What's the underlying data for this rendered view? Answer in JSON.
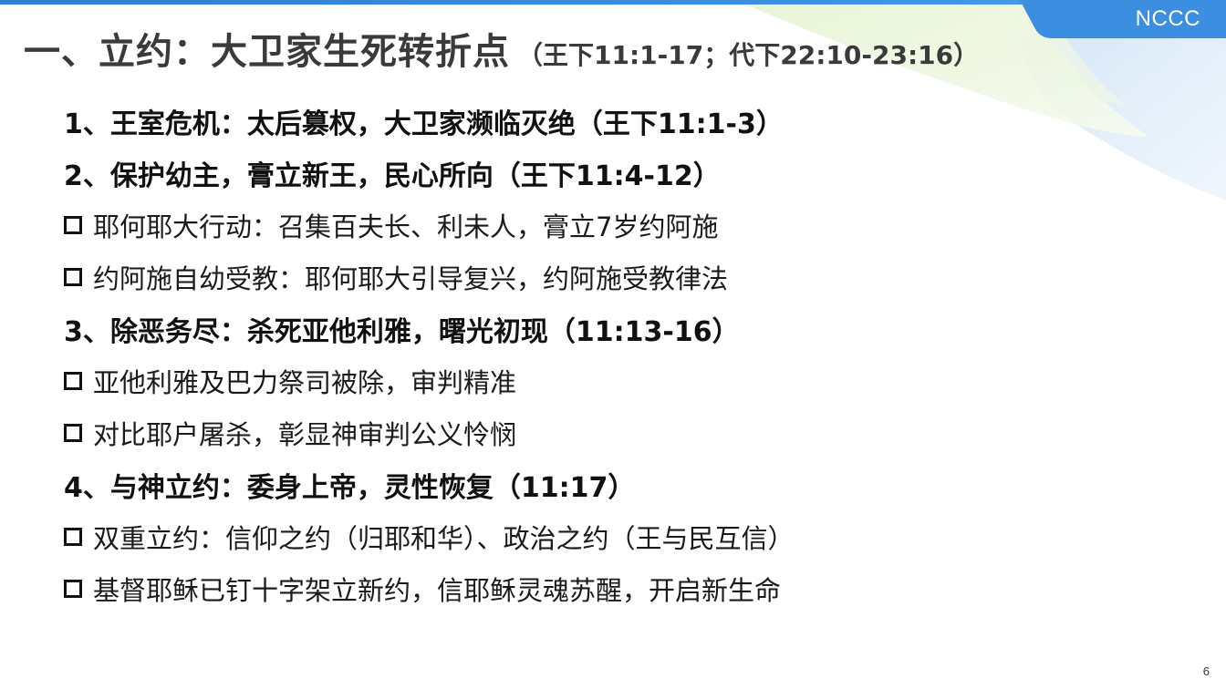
{
  "brand": {
    "label": "NCCC"
  },
  "title": {
    "main": "一、立约：大卫家生死转折点",
    "ref": "（王下11:1-17；代下22:10-23:16）"
  },
  "items": [
    {
      "kind": "heading",
      "text": "1、王室危机：太后篡权，大卫家濒临灭绝（王下11:1-3）"
    },
    {
      "kind": "heading",
      "text": "2、保护幼主，膏立新王，民心所向（王下11:4-12）"
    },
    {
      "kind": "bullet",
      "text": "耶何耶大行动：召集百夫长、利未人，膏立7岁约阿施"
    },
    {
      "kind": "bullet",
      "text": "约阿施自幼受教：耶何耶大引导复兴，约阿施受教律法"
    },
    {
      "kind": "heading",
      "text": "3、除恶务尽：杀死亚他利雅，曙光初现（11:13-16）"
    },
    {
      "kind": "bullet",
      "text": "亚他利雅及巴力祭司被除，审判精准"
    },
    {
      "kind": "bullet",
      "text": "对比耶户屠杀，彰显神审判公义怜悯"
    },
    {
      "kind": "heading",
      "text": "4、与神立约：委身上帝，灵性恢复（11:17）"
    },
    {
      "kind": "bullet",
      "text": "双重立约：信仰之约（归耶和华）、政治之约（王与民互信）"
    },
    {
      "kind": "bullet",
      "text": "基督耶稣已钉十字架立新约，信耶稣灵魂苏醒，开启新生命"
    }
  ],
  "page_number": "6",
  "colors": {
    "accent_blue": "#2f7fd0",
    "decor_green": "#e8f4d6",
    "decor_blue": "#dbeaf8"
  }
}
